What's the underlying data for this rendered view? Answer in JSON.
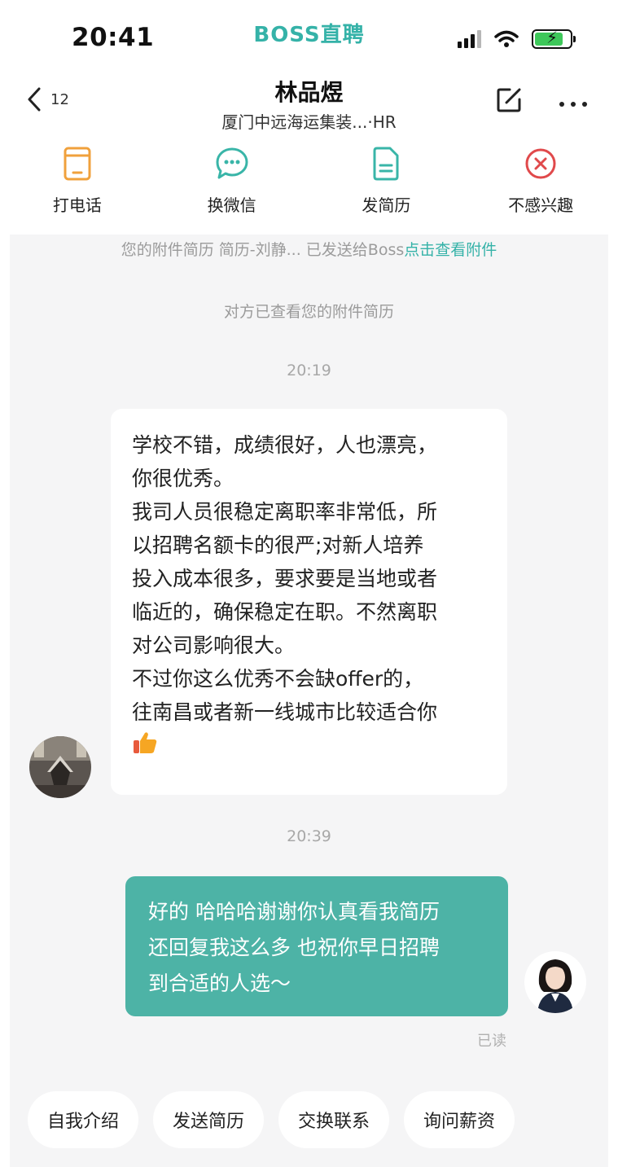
{
  "status_bar": {
    "time": "20:41",
    "brand": "BOSS直聘",
    "battery_level": 0.8,
    "battery_color": "#3ec85a"
  },
  "header": {
    "back_count": "12",
    "name": "林品煜",
    "subtitle": "厦门中远海运集装...·HR",
    "back_icon": "chevron-left-icon",
    "edit_icon": "edit-icon",
    "more_icon": "more-icon"
  },
  "actions": [
    {
      "label": "打电话",
      "icon": "phone-icon",
      "color": "#f0a13c"
    },
    {
      "label": "换微信",
      "icon": "wechat-icon",
      "color": "#39b5a8"
    },
    {
      "label": "发简历",
      "icon": "resume-icon",
      "color": "#39b5a8"
    },
    {
      "label": "不感兴趣",
      "icon": "close-circle-icon",
      "color": "#e0494b"
    }
  ],
  "chat": {
    "resume_notice": "您的附件简历 简历-刘静... 已发送给Boss",
    "resume_link": "点击查看附件",
    "viewed_notice": "对方已查看您的附件简历",
    "time_1": "20:19",
    "incoming_message": "学校不错，成绩很好，人也漂亮，\n你很优秀。\n我司人员很稳定离职率非常低，所\n以招聘名额卡的很严;对新人培养\n投入成本很多，要求要是当地或者\n临近的，确保稳定在职。不然离职\n对公司影响很大。\n不过你这么优秀不会缺offer的，\n往南昌或者新一线城市比较适合你",
    "time_2": "20:39",
    "outgoing_message": "好的 哈哈哈谢谢你认真看我简历\n还回复我这么多 也祝你早日招聘\n到合适的人选～",
    "read_status": "已读",
    "accent_color": "#4db3a6"
  },
  "quick_replies": [
    "自我介绍",
    "发送简历",
    "交换联系",
    "询问薪资"
  ]
}
